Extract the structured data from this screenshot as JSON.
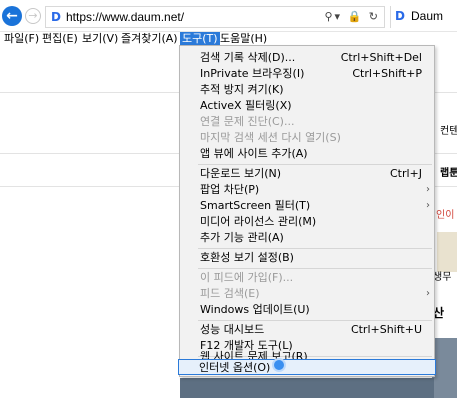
{
  "browser": {
    "url": "https://www.daum.net/",
    "tab_title": "Daum",
    "site_icon": "D"
  },
  "menubar": {
    "items": [
      {
        "label": "파일(F)"
      },
      {
        "label": "편집(E)"
      },
      {
        "label": "보기(V)"
      },
      {
        "label": "즐겨찾기(A)"
      },
      {
        "label": "도구(T)"
      },
      {
        "label": "도움말(H)"
      }
    ]
  },
  "dropdown": {
    "items": [
      {
        "label": "검색 기록 삭제(D)...",
        "shortcut": "Ctrl+Shift+Del"
      },
      {
        "label": "InPrivate 브라우징(I)",
        "shortcut": "Ctrl+Shift+P"
      },
      {
        "label": "추적 방지 켜기(K)",
        "shortcut": ""
      },
      {
        "label": "ActiveX 필터링(X)",
        "shortcut": ""
      },
      {
        "label": "연결 문제 진단(C)...",
        "shortcut": ""
      },
      {
        "label": "마지막 검색 세션 다시 열기(S)",
        "shortcut": ""
      },
      {
        "label": "앱 뷰에 사이트 추가(A)",
        "shortcut": ""
      },
      {
        "label": "다운로드 보기(N)",
        "shortcut": "Ctrl+J"
      },
      {
        "label": "팝업 차단(P)",
        "shortcut": ""
      },
      {
        "label": "SmartScreen 필터(T)",
        "shortcut": ""
      },
      {
        "label": "미디어 라이선스 관리(M)",
        "shortcut": ""
      },
      {
        "label": "추가 기능 관리(A)",
        "shortcut": ""
      },
      {
        "label": "호환성 보기 설정(B)",
        "shortcut": ""
      },
      {
        "label": "이 피드에 가입(F)...",
        "shortcut": ""
      },
      {
        "label": "피드 검색(E)",
        "shortcut": ""
      },
      {
        "label": "Windows 업데이트(U)",
        "shortcut": ""
      },
      {
        "label": "성능 대시보드",
        "shortcut": "Ctrl+Shift+U"
      },
      {
        "label": "F12 개발자 도구(L)",
        "shortcut": ""
      },
      {
        "label": "웹 사이트 문제 보고(R)",
        "shortcut": ""
      },
      {
        "label": "인터넷 옵션(O)",
        "shortcut": ""
      }
    ]
  },
  "page": {
    "fragments": [
      "컨텐",
      "랩툰",
      "인이",
      "생무",
      "산"
    ]
  },
  "colors": {
    "accent": "#2b7ad9",
    "disabled": "#9a9a9a",
    "back_button": "#1a73d9"
  }
}
